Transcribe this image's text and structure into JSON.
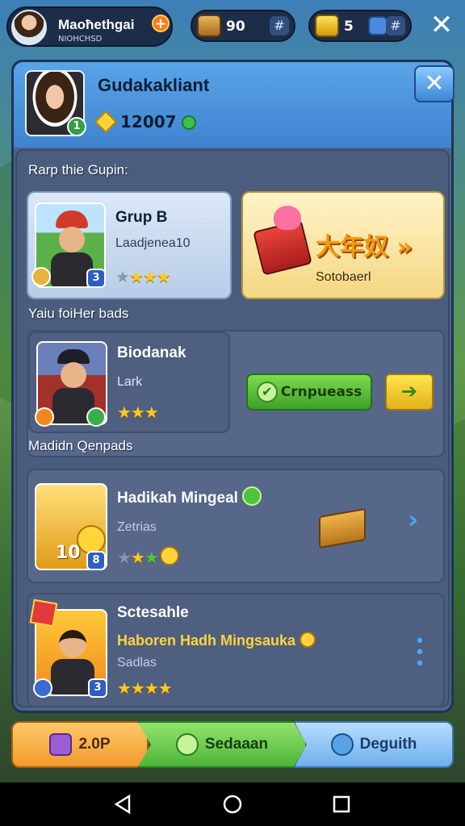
{
  "topbar": {
    "player_name": "Maoħethgai",
    "player_sub": "NIOHCHSD",
    "plus": "+",
    "resource_1": {
      "value": "90",
      "add": "#",
      "icon": "chest-icon"
    },
    "resource_2": {
      "value": "5",
      "add": "#",
      "icon": "gold-cup-icon"
    },
    "close": "✕"
  },
  "panel": {
    "title": "Gudakakliant",
    "coins": "12007",
    "level_badge": "1",
    "close": "✕",
    "section_1": "Rarp thie Gupin:",
    "section_2": "Yaiu foiHer bads",
    "section_3": "Madidn Qenpads",
    "card_group": {
      "name": "Grup B",
      "sub": "Laadjenea10",
      "badge": "3",
      "stars_filled": 3,
      "stars_total": 4
    },
    "card_gift": {
      "title": "大年奴 »",
      "sub": "Sotobaerl"
    },
    "card_player": {
      "name": "Biodanak",
      "sub": "Lark",
      "stars_filled": 3
    },
    "btn_confirm": "Crnpueass",
    "btn_arrow": "➔",
    "card_weekly": {
      "name": "Hadikah Mingeal",
      "sub": "Zetrias",
      "thumb_label": "10",
      "badge": "8"
    },
    "card_special": {
      "name": "Sctesahle",
      "highlight": "Haboren Hadh Mingsauka",
      "sub": "Sadlas",
      "badge": "3",
      "stars_filled": 4
    }
  },
  "tabs": [
    {
      "label": "2.0P"
    },
    {
      "label": "Sedaaan"
    },
    {
      "label": "Deguith"
    }
  ],
  "colors": {
    "accent_blue": "#49a6ff",
    "gold": "#ffc81e",
    "green": "#4eb53a"
  }
}
